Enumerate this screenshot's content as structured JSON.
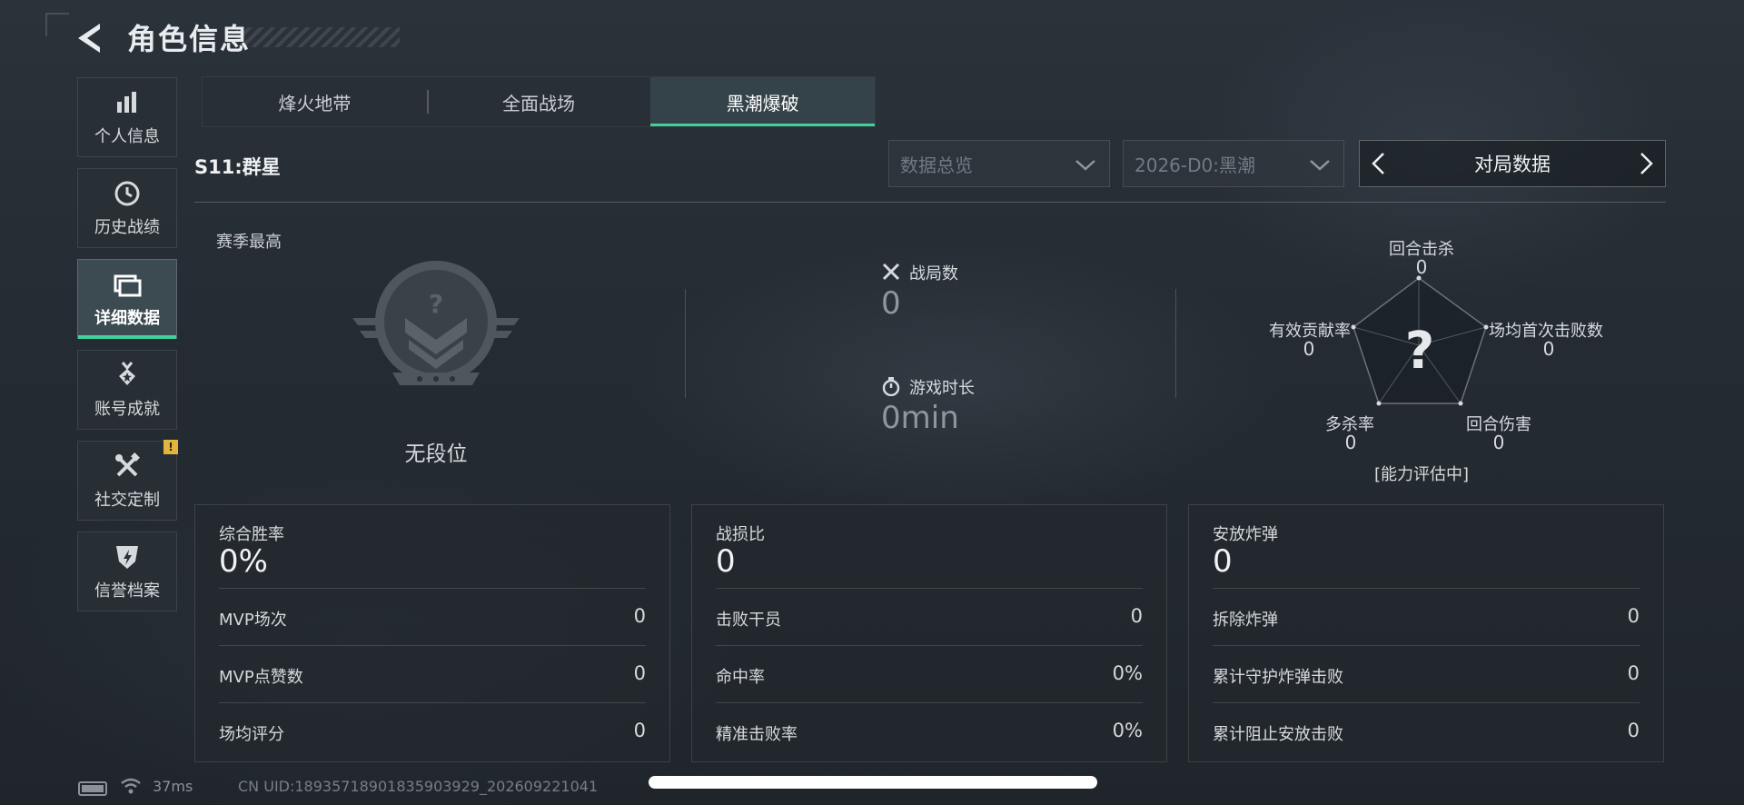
{
  "header": {
    "title": "角色信息"
  },
  "sidebar": {
    "items": [
      {
        "label": "个人信息",
        "icon": "bar-chart-icon"
      },
      {
        "label": "历史战绩",
        "icon": "history-icon"
      },
      {
        "label": "详细数据",
        "icon": "folder-icon",
        "active": true
      },
      {
        "label": "账号成就",
        "icon": "medal-icon"
      },
      {
        "label": "社交定制",
        "icon": "tools-icon",
        "badge": "!"
      },
      {
        "label": "信誉档案",
        "icon": "shield-icon"
      }
    ]
  },
  "tabs": [
    {
      "label": "烽火地带"
    },
    {
      "label": "全面战场"
    },
    {
      "label": "黑潮爆破",
      "active": true
    }
  ],
  "season": "S11:群星",
  "filters": {
    "data_view": "数据总览",
    "season_select": "2026-D0:黑潮"
  },
  "stat_nav": {
    "label": "对局数据"
  },
  "rank": {
    "season_high_label": "赛季最高",
    "label": "无段位",
    "emblem_mark": "?"
  },
  "metrics": {
    "matches": {
      "label": "战局数",
      "value": "0"
    },
    "playtime": {
      "label": "游戏时长",
      "value": "0min"
    }
  },
  "radar": {
    "center_mark": "?",
    "axes": [
      {
        "label": "回合击杀",
        "value": "0"
      },
      {
        "label": "场均首次击败数",
        "value": "0"
      },
      {
        "label": "回合伤害",
        "value": "0"
      },
      {
        "label": "多杀率",
        "value": "0"
      },
      {
        "label": "有效贡献率",
        "value": "0"
      }
    ],
    "status": "[能力评估中]"
  },
  "panels": [
    {
      "title": "综合胜率",
      "value": "0%",
      "rows": [
        {
          "label": "MVP场次",
          "value": "0"
        },
        {
          "label": "MVP点赞数",
          "value": "0"
        },
        {
          "label": "场均评分",
          "value": "0"
        }
      ]
    },
    {
      "title": "战损比",
      "value": "0",
      "rows": [
        {
          "label": "击败干员",
          "value": "0"
        },
        {
          "label": "命中率",
          "value": "0%"
        },
        {
          "label": "精准击败率",
          "value": "0%"
        }
      ]
    },
    {
      "title": "安放炸弹",
      "value": "0",
      "rows": [
        {
          "label": "拆除炸弹",
          "value": "0"
        },
        {
          "label": "累计守护炸弹击败",
          "value": "0"
        },
        {
          "label": "累计阻止安放击败",
          "value": "0"
        }
      ]
    }
  ],
  "footer": {
    "ping": "37ms",
    "uid": "CN UID:18935718901835903929_202609221041"
  },
  "colors": {
    "accent": "#3fd39b",
    "badge": "#e2b53c"
  }
}
